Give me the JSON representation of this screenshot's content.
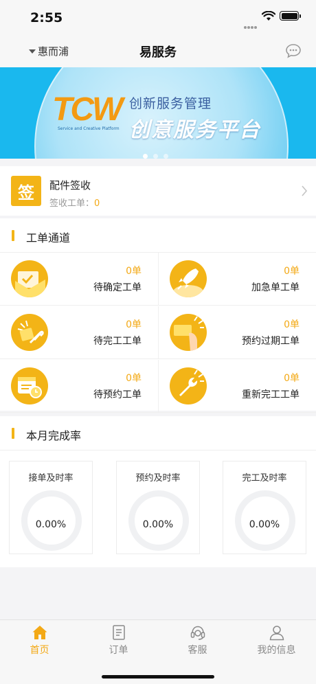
{
  "status_bar": {
    "time": "2:55"
  },
  "nav": {
    "location": "惠而浦",
    "title": "易服务"
  },
  "banner": {
    "logo_text": "TCW",
    "logo_sub": "Service and Creative Platform",
    "subtitle": "创新服务管理",
    "headline": "创意服务平台",
    "dots": 3,
    "active_dot": 1
  },
  "parts": {
    "badge": "签",
    "title": "配件签收",
    "sub_label": "签收工单：",
    "sub_count": "0"
  },
  "orders": {
    "title": "工单通道",
    "items": [
      {
        "count": "0单",
        "label": "待确定工单"
      },
      {
        "count": "0单",
        "label": "加急单工单"
      },
      {
        "count": "0单",
        "label": "待完工工单"
      },
      {
        "count": "0单",
        "label": "预约过期工单"
      },
      {
        "count": "0单",
        "label": "待预约工单"
      },
      {
        "count": "0单",
        "label": "重新完工工单"
      }
    ]
  },
  "rate": {
    "title": "本月完成率",
    "cards": [
      {
        "title": "接单及时率",
        "value": "0.00%"
      },
      {
        "title": "预约及时率",
        "value": "0.00%"
      },
      {
        "title": "完工及时率",
        "value": "0.00%"
      }
    ]
  },
  "tabs": [
    {
      "label": "首页",
      "icon": "home-icon",
      "active": true
    },
    {
      "label": "订单",
      "icon": "document-icon",
      "active": false
    },
    {
      "label": "客服",
      "icon": "headset-icon",
      "active": false
    },
    {
      "label": "我的信息",
      "icon": "user-icon",
      "active": false
    }
  ],
  "colors": {
    "accent": "#f3b417",
    "accent_text": "#f3a916",
    "banner_bg": "#1ab8ee"
  }
}
